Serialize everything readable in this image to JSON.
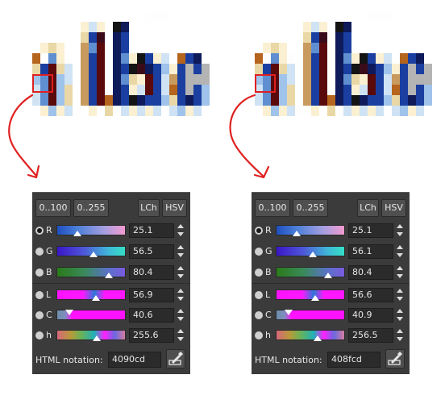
{
  "panels": [
    {
      "buttons": {
        "range_100": "0..100",
        "range_255": "0..255",
        "lch": "LCh",
        "hsv": "HSV"
      },
      "channels": [
        {
          "name": "R",
          "value": "25.1",
          "checked": true
        },
        {
          "name": "G",
          "value": "56.5",
          "checked": false
        },
        {
          "name": "B",
          "value": "80.4",
          "checked": false
        },
        {
          "name": "L",
          "value": "56.9",
          "checked": false
        },
        {
          "name": "C",
          "value": "40.6",
          "checked": false
        },
        {
          "name": "h",
          "value": "255.6",
          "checked": false
        }
      ],
      "html_label": "HTML notation:",
      "html_value": "4090cd"
    },
    {
      "buttons": {
        "range_100": "0..100",
        "range_255": "0..255",
        "lch": "LCh",
        "hsv": "HSV"
      },
      "channels": [
        {
          "name": "R",
          "value": "25.1",
          "checked": true
        },
        {
          "name": "G",
          "value": "56.1",
          "checked": false
        },
        {
          "name": "B",
          "value": "80.4",
          "checked": false
        },
        {
          "name": "L",
          "value": "56.6",
          "checked": false
        },
        {
          "name": "C",
          "value": "40.9",
          "checked": false
        },
        {
          "name": "h",
          "value": "256.5",
          "checked": false
        }
      ],
      "html_label": "HTML notation:",
      "html_value": "408fcd"
    }
  ],
  "colors": {
    "panel_bg": "#3b3b3b",
    "annotation_red": "#e02020"
  },
  "icons": [
    "color-picker-icon",
    "spin-up-icon",
    "spin-down-icon"
  ]
}
